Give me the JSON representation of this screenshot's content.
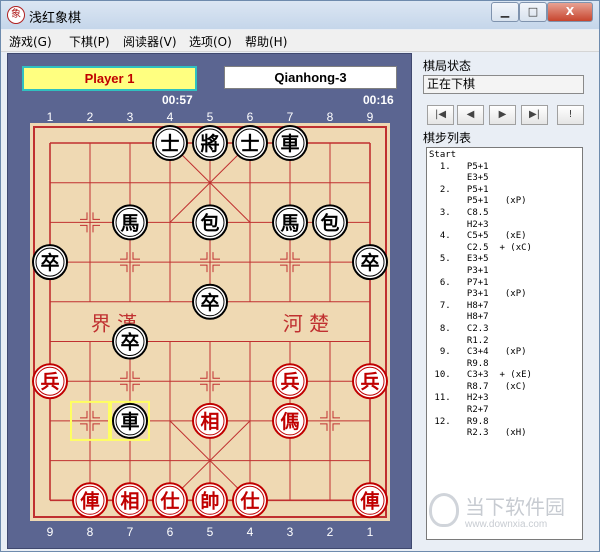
{
  "window": {
    "title": "浅红象棋",
    "app_icon_glyph": "象",
    "minimize_label": "▁",
    "maximize_label": "□",
    "close_label": "X"
  },
  "menu": [
    "游戏(G)",
    "下棋(P)",
    "阅读器(V)",
    "选项(O)",
    "帮助(H)"
  ],
  "players": {
    "red": {
      "name": "Player 1",
      "time": "00:57"
    },
    "black": {
      "name": "Qianhong-3",
      "time": "00:16"
    }
  },
  "board": {
    "top_numbers": [
      "1",
      "2",
      "3",
      "4",
      "5",
      "6",
      "7",
      "8",
      "9"
    ],
    "bottom_numbers": [
      "9",
      "8",
      "7",
      "6",
      "5",
      "4",
      "3",
      "2",
      "1"
    ],
    "river_left": "界  漢",
    "river_right": "河  楚",
    "colors": {
      "red": "#c00000",
      "black": "#000000",
      "line": "#c03030",
      "board": "#efd9b3",
      "highlight": "#ffff60"
    },
    "pieces": [
      {
        "char": "士",
        "side": "black",
        "col": 3,
        "row": 0
      },
      {
        "char": "將",
        "side": "black",
        "col": 4,
        "row": 0
      },
      {
        "char": "士",
        "side": "black",
        "col": 5,
        "row": 0
      },
      {
        "char": "車",
        "side": "black",
        "col": 6,
        "row": 0
      },
      {
        "char": "馬",
        "side": "black",
        "col": 2,
        "row": 2
      },
      {
        "char": "包",
        "side": "black",
        "col": 4,
        "row": 2
      },
      {
        "char": "馬",
        "side": "black",
        "col": 6,
        "row": 2
      },
      {
        "char": "包",
        "side": "black",
        "col": 7,
        "row": 2
      },
      {
        "char": "卒",
        "side": "black",
        "col": 0,
        "row": 3
      },
      {
        "char": "卒",
        "side": "black",
        "col": 8,
        "row": 3
      },
      {
        "char": "卒",
        "side": "black",
        "col": 4,
        "row": 4
      },
      {
        "char": "卒",
        "side": "black",
        "col": 2,
        "row": 5
      },
      {
        "char": "兵",
        "side": "red",
        "col": 0,
        "row": 6
      },
      {
        "char": "兵",
        "side": "red",
        "col": 6,
        "row": 6
      },
      {
        "char": "兵",
        "side": "red",
        "col": 8,
        "row": 6
      },
      {
        "char": "車",
        "side": "black",
        "col": 2,
        "row": 7
      },
      {
        "char": "相",
        "side": "red",
        "col": 4,
        "row": 7
      },
      {
        "char": "傌",
        "side": "red",
        "col": 6,
        "row": 7
      },
      {
        "char": "俥",
        "side": "red",
        "col": 1,
        "row": 9
      },
      {
        "char": "相",
        "side": "red",
        "col": 2,
        "row": 9
      },
      {
        "char": "仕",
        "side": "red",
        "col": 3,
        "row": 9
      },
      {
        "char": "帥",
        "side": "red",
        "col": 4,
        "row": 9
      },
      {
        "char": "仕",
        "side": "red",
        "col": 5,
        "row": 9
      },
      {
        "char": "俥",
        "side": "red",
        "col": 8,
        "row": 9
      }
    ],
    "highlight_squares": [
      {
        "col": 1,
        "row": 7
      },
      {
        "col": 2,
        "row": 7
      }
    ]
  },
  "side_panel": {
    "status_label": "棋局状态",
    "status_value": "正在下棋",
    "nav_buttons": [
      "|◀",
      "◀",
      "▶",
      "▶|",
      "!"
    ],
    "move_list_label": "棋步列表",
    "move_list": [
      "Start",
      "  1.   P5+1",
      "       E3+5",
      "  2.   P5+1",
      "       P5+1   (xP)",
      "  3.   C8.5",
      "       H2+3",
      "  4.   C5+5   (xE)",
      "       C2.5  + (xC)",
      "  5.   E3+5",
      "       P3+1",
      "  6.   P7+1",
      "       P3+1   (xP)",
      "  7.   H8+7",
      "       H8+7",
      "  8.   C2.3",
      "       R1.2",
      "  9.   C3+4   (xP)",
      "       R9.8",
      " 10.   C3+3  + (xE)",
      "       R8.7   (xC)",
      " 11.   H2+3",
      "       R2+7",
      " 12.   R9.8",
      "       R2.3   (xH)"
    ]
  },
  "watermark": {
    "text": "当下软件园",
    "url": "www.downxia.com"
  }
}
